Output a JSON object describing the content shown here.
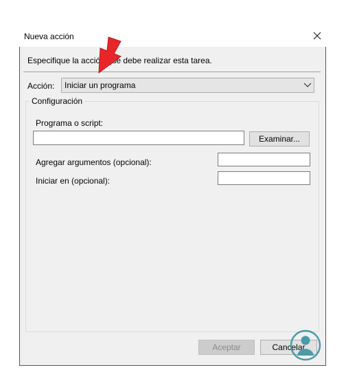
{
  "window": {
    "title": "Nueva acción"
  },
  "prompt": "Especifique la acción que debe realizar esta tarea.",
  "action": {
    "label": "Acción:",
    "selected": "Iniciar un programa"
  },
  "config": {
    "legend": "Configuración",
    "program_label": "Programa o script:",
    "program_value": "",
    "browse_label": "Examinar...",
    "args_label": "Agregar argumentos (opcional):",
    "args_value": "",
    "start_label": "Iniciar en (opcional):",
    "start_value": ""
  },
  "buttons": {
    "accept": "Aceptar",
    "cancel": "Cancelar"
  },
  "icons": {
    "close": "close-icon",
    "dropdown": "chevron-down-icon",
    "annotation": "red-arrow-icon",
    "watermark": "solvetic-logo-icon"
  },
  "colors": {
    "arrow": "#e8262a",
    "logo": "#4a9aa8",
    "dialog_bg": "#f0f0f0"
  }
}
